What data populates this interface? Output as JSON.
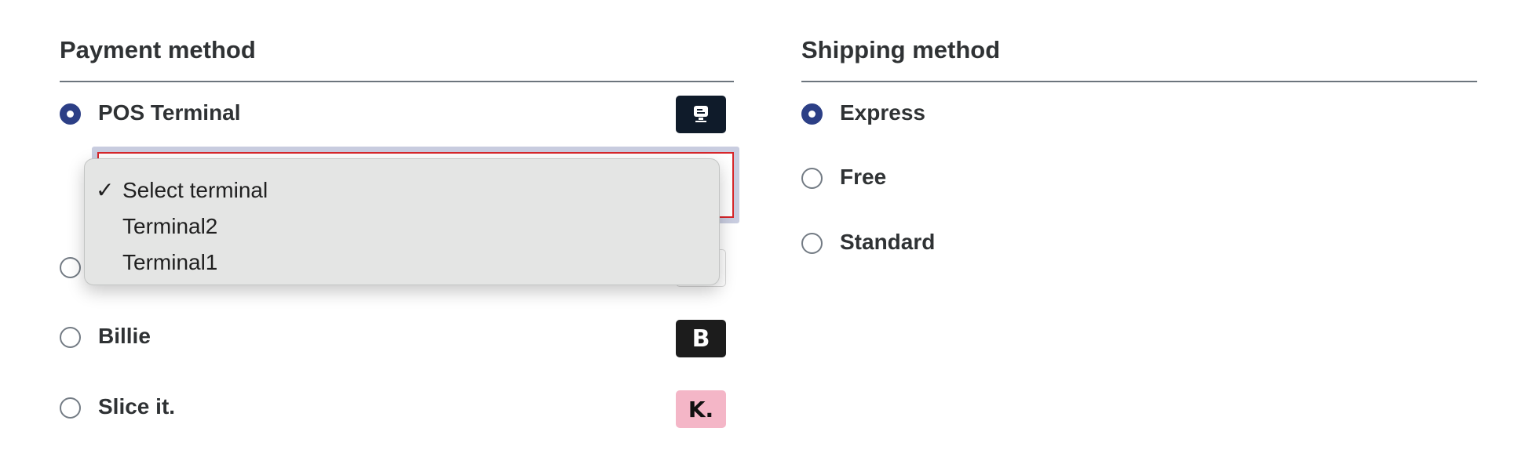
{
  "payment": {
    "heading": "Payment method",
    "methods": [
      {
        "label": "POS Terminal",
        "selected": true,
        "logo_icon": "pos-terminal-icon"
      },
      {
        "label": "",
        "selected": false,
        "logo_icon": "unknown-logo"
      },
      {
        "label": "Billie",
        "selected": false,
        "logo_icon": "billie-logo",
        "logo_text": "B"
      },
      {
        "label": "Slice it.",
        "selected": false,
        "logo_icon": "klarna-logo",
        "logo_text": "K."
      }
    ],
    "terminal_select": {
      "options": [
        "Select terminal",
        "Terminal2",
        "Terminal1"
      ],
      "selected_option": "Select terminal",
      "check_mark": "✓"
    }
  },
  "shipping": {
    "heading": "Shipping method",
    "methods": [
      {
        "label": "Express",
        "selected": true
      },
      {
        "label": "Free",
        "selected": false
      },
      {
        "label": "Standard",
        "selected": false
      }
    ]
  },
  "colors": {
    "radio_checked": "#2c3f86",
    "error_border": "#d7262b",
    "klarna_pink": "#f4b6c7",
    "billie_dark": "#1c1c1c"
  }
}
